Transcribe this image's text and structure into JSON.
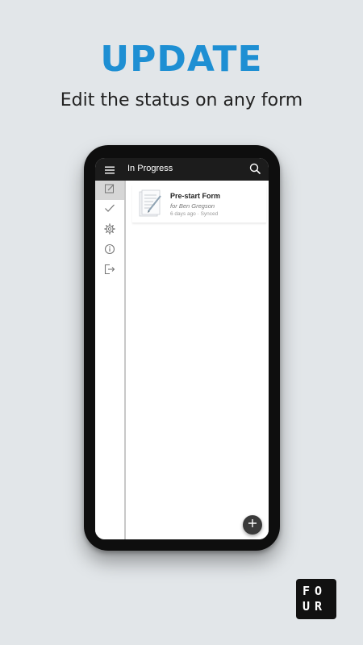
{
  "promo": {
    "headline": "UPDATE",
    "subheadline": "Edit the status on any form"
  },
  "colors": {
    "accent": "#1e8fd3",
    "background": "#e2e6e9",
    "appbar": "#1c1c1c"
  },
  "appbar": {
    "title": "In Progress",
    "menu_icon": "hamburger-menu-icon",
    "search_icon": "search-icon"
  },
  "sidebar": {
    "items": [
      {
        "name": "in-progress",
        "icon": "edit-icon",
        "active": true
      },
      {
        "name": "completed",
        "icon": "checkmark-icon",
        "active": false
      },
      {
        "name": "settings",
        "icon": "gear-icon",
        "active": false
      },
      {
        "name": "info",
        "icon": "info-icon",
        "active": false
      },
      {
        "name": "logout",
        "icon": "logout-icon",
        "active": false
      }
    ]
  },
  "forms": [
    {
      "title": "Pre-start Form",
      "subtitle": "for Ben Gregson",
      "meta": "6 days ago · Synced",
      "icon": "document-thumbnail-icon"
    }
  ],
  "fab": {
    "icon": "plus-icon"
  },
  "logo": {
    "row1": "FO",
    "row2": "UR"
  }
}
